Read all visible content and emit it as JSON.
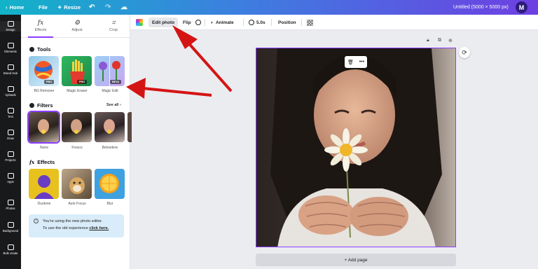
{
  "topbar": {
    "home": "Home",
    "file": "File",
    "resize": "Resize",
    "title": "Untitled (5000 × 5000 px)",
    "avatar": "M"
  },
  "rail": {
    "items": [
      "Design",
      "Elements",
      "Brand Hub",
      "Uploads",
      "Text",
      "Draw",
      "Projects",
      "Apps",
      "Photos",
      "Background",
      "Bulk create"
    ]
  },
  "panel": {
    "tabs": [
      "Effects",
      "Adjust",
      "Crop"
    ],
    "tools_title": "Tools",
    "tools": [
      {
        "label": "BG Remover",
        "badge": "PRO"
      },
      {
        "label": "Magic Eraser",
        "badge": "PRO"
      },
      {
        "label": "Magic Edit",
        "badge": "BETA"
      }
    ],
    "filters_title": "Filters",
    "see_all": "See all",
    "filters": [
      "None",
      "Fresco",
      "Belvedere"
    ],
    "effects_title": "Effects",
    "effects": [
      "Duotone",
      "Auto Focus",
      "Blur"
    ],
    "notice": {
      "line1": "You're using the new photo editor.",
      "line2": "To use the old experience",
      "link": "click here."
    }
  },
  "toolbar": {
    "edit_photo": "Edit photo",
    "flip": "Flip",
    "animate": "Animate",
    "duration": "5.0s",
    "position": "Position"
  },
  "canvas": {
    "add_page": "+ Add page"
  },
  "colors": {
    "accent": "#8b3dff",
    "arrow": "#d41414"
  }
}
